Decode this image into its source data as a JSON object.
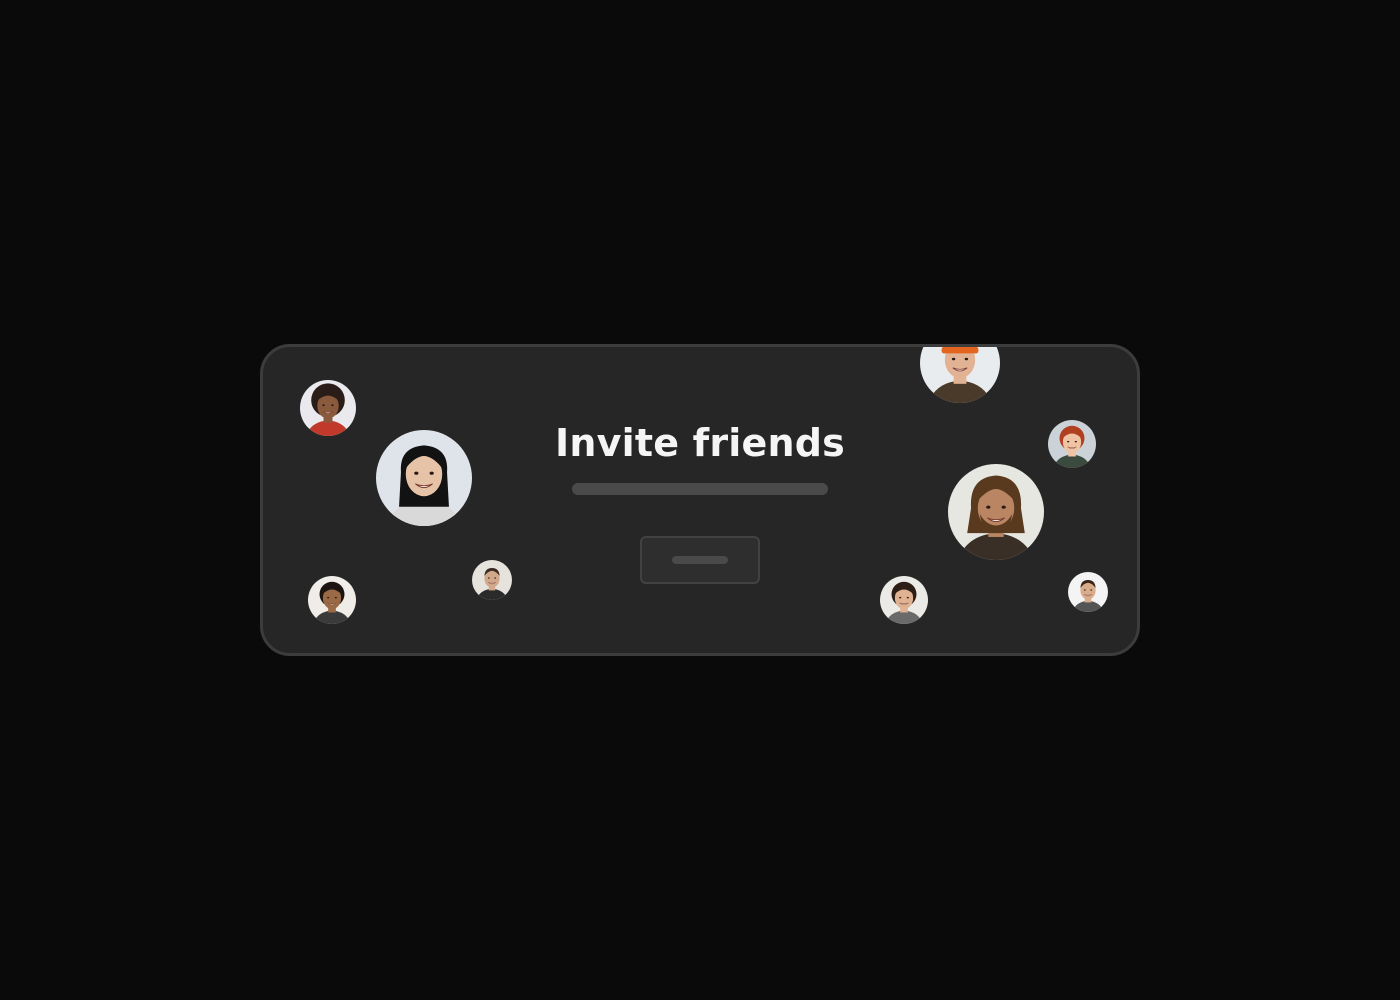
{
  "card": {
    "title": "Invite friends"
  },
  "avatars": [
    {
      "id": "friend-1",
      "bg": "#e9e9ee",
      "skin": "#8a5a3c",
      "hair": "#2a1d17",
      "style": "afro",
      "accent": "#c0392b"
    },
    {
      "id": "friend-2",
      "bg": "#dfe4ea",
      "skin": "#e6c2a6",
      "hair": "#121212",
      "style": "long",
      "accent": "#d9d9d9"
    },
    {
      "id": "friend-3",
      "bg": "#f0ede8",
      "skin": "#9a6a46",
      "hair": "#1c1410",
      "style": "curly",
      "accent": "#3a3a3a"
    },
    {
      "id": "friend-4",
      "bg": "#e6e3dc",
      "skin": "#d2a88a",
      "hair": "#3a2a20",
      "style": "parted",
      "accent": "#2a2a2a"
    },
    {
      "id": "friend-5",
      "bg": "#e9ecef",
      "skin": "#e1b394",
      "hair": "#e2651f",
      "style": "beanie",
      "accent": "#4a3a2a"
    },
    {
      "id": "friend-6",
      "bg": "#cbd3d9",
      "skin": "#efc3a4",
      "hair": "#b0401f",
      "style": "curly",
      "accent": "#3b4a3f"
    },
    {
      "id": "friend-7",
      "bg": "#e7e7e2",
      "skin": "#b98563",
      "hair": "#5a3a1e",
      "style": "dreads",
      "accent": "#3a2f26"
    },
    {
      "id": "friend-8",
      "bg": "#eceae6",
      "skin": "#dfb292",
      "hair": "#2d1e15",
      "style": "curly",
      "accent": "#6a6a6a"
    },
    {
      "id": "friend-9",
      "bg": "#f4f4f4",
      "skin": "#d9ad8c",
      "hair": "#3b2418",
      "style": "parted",
      "accent": "#555555"
    }
  ]
}
